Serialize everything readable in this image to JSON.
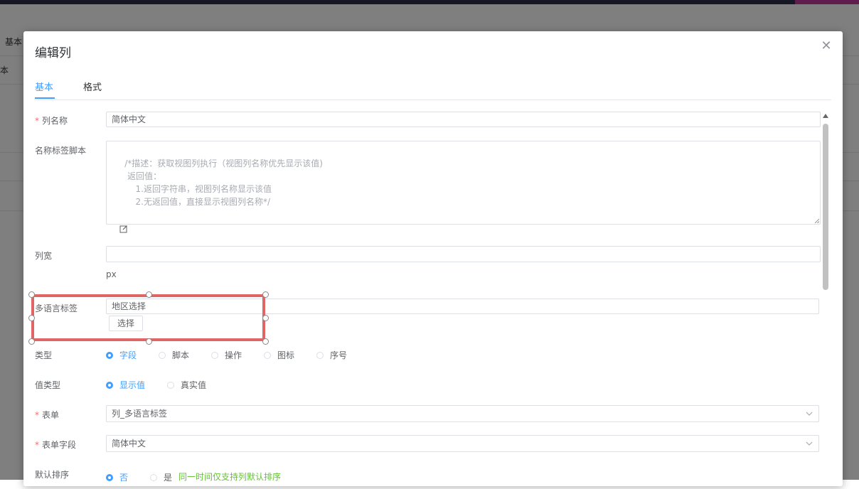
{
  "background": {
    "row1_label": "基本",
    "row2_label": "本"
  },
  "dialog": {
    "title": "编辑列",
    "close_icon": "close-icon",
    "tabs": [
      {
        "label": "基本",
        "active": true
      },
      {
        "label": "格式",
        "active": false
      }
    ],
    "fields": {
      "column_name": {
        "label": "列名称",
        "required": true,
        "value": "简体中文"
      },
      "name_label_script": {
        "label": "名称标签脚本",
        "placeholder": "/*描述：获取视图列执行（视图列名称优先显示该值)\n     返回值：\n        1.返回字符串，视图列名称显示该值\n        2.无返回值，直接显示视图列名称*/"
      },
      "column_width": {
        "label": "列宽",
        "value": "",
        "unit": "px"
      },
      "i18n_label": {
        "label": "多语言标签",
        "value": "地区选择",
        "button": "选择"
      },
      "type": {
        "label": "类型",
        "options": [
          "字段",
          "脚本",
          "操作",
          "图标",
          "序号"
        ],
        "selected": "字段"
      },
      "value_type": {
        "label": "值类型",
        "options": [
          "显示值",
          "真实值"
        ],
        "selected": "显示值"
      },
      "form": {
        "label": "表单",
        "required": true,
        "value": "列_多语言标签"
      },
      "form_field": {
        "label": "表单字段",
        "required": true,
        "value": "简体中文"
      },
      "default_sort": {
        "label": "默认排序",
        "options": [
          "否",
          "是"
        ],
        "selected": "否",
        "hint": "同一时间仅支持列默认排序"
      }
    }
  },
  "colors": {
    "primary": "#409eff",
    "required": "#f56c6c",
    "hint": "#67c23a",
    "annotation": "#e06666"
  }
}
